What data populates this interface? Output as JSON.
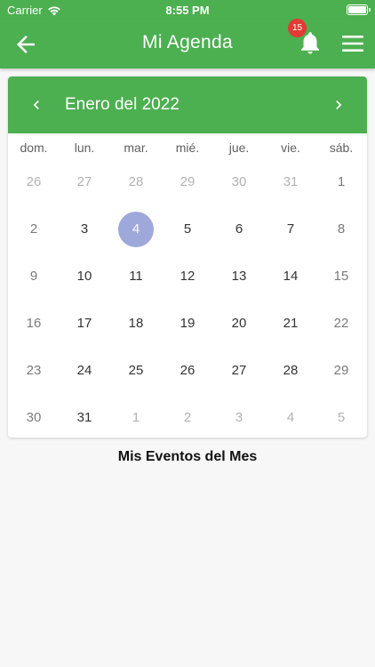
{
  "status": {
    "carrier": "Carrier",
    "time": "8:55 PM"
  },
  "appbar": {
    "title": "Mi Agenda",
    "notification_count": "15"
  },
  "calendar": {
    "month_label": "Enero del 2022",
    "weekdays": [
      "dom.",
      "lun.",
      "mar.",
      "mié.",
      "jue.",
      "vie.",
      "sáb."
    ],
    "weeks": [
      [
        "26",
        "27",
        "28",
        "29",
        "30",
        "31",
        "1"
      ],
      [
        "2",
        "3",
        "4",
        "5",
        "6",
        "7",
        "8"
      ],
      [
        "9",
        "10",
        "11",
        "12",
        "13",
        "14",
        "15"
      ],
      [
        "16",
        "17",
        "18",
        "19",
        "20",
        "21",
        "22"
      ],
      [
        "23",
        "24",
        "25",
        "26",
        "27",
        "28",
        "29"
      ],
      [
        "30",
        "31",
        "1",
        "2",
        "3",
        "4",
        "5"
      ]
    ],
    "selected_day": "4",
    "colors": {
      "primary": "#4caf50",
      "selected": "#9fa8da"
    }
  },
  "events": {
    "title": "Mis Eventos del Mes"
  },
  "icons": [
    "wifi-icon",
    "battery-icon",
    "back-arrow-icon",
    "bell-icon",
    "menu-icon",
    "chevron-left-icon",
    "chevron-right-icon"
  ]
}
